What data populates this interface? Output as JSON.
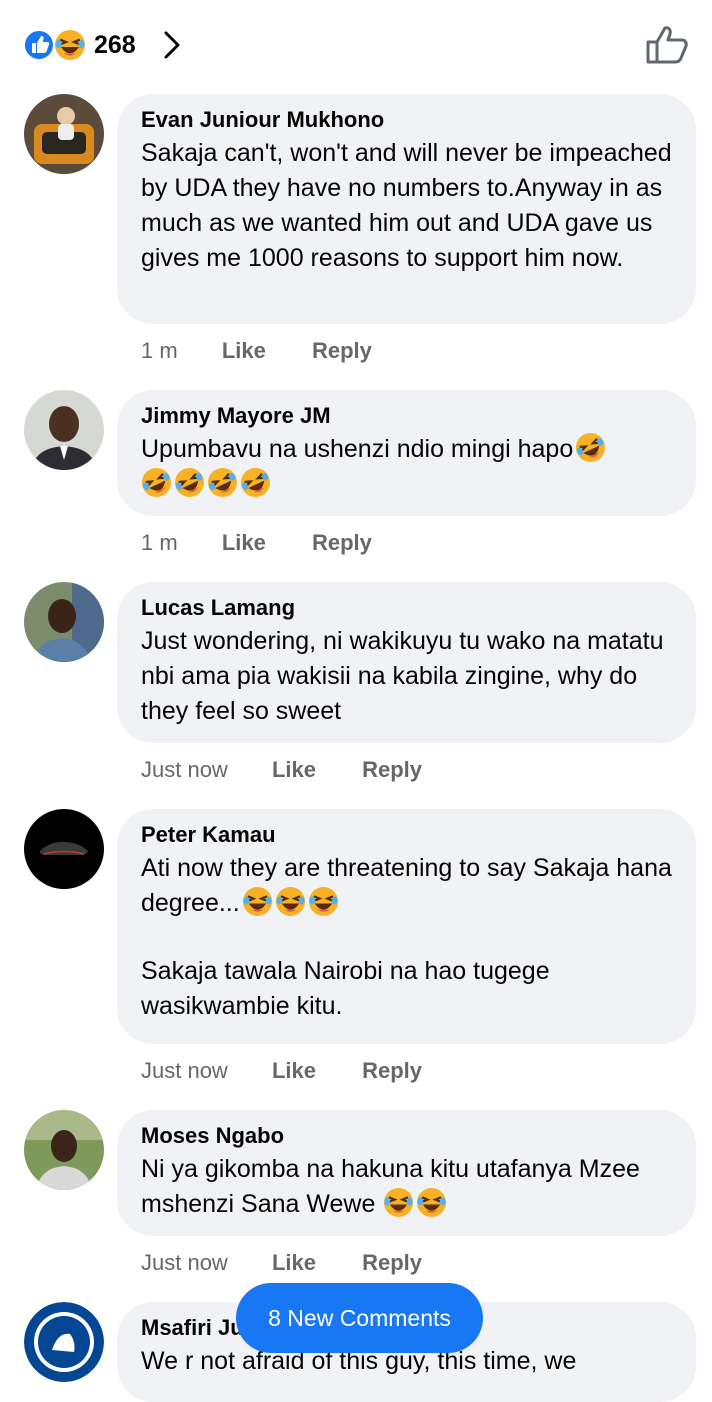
{
  "header": {
    "reaction_count": "268",
    "reaction_icons": [
      "like-icon",
      "haha-icon"
    ],
    "like_icon": "thumbs-up-outline-icon"
  },
  "comments": [
    {
      "author": "Evan Juniour Mukhono",
      "text": "Sakaja can't, won't and will never be impeached by UDA they have no numbers to.Anyway in as much as we wanted him out and UDA gave us gives me 1000 reasons to support him now.",
      "time": "1 m",
      "like": "Like",
      "reply": "Reply"
    },
    {
      "author": "Jimmy Mayore JM",
      "text": "Upumbavu na ushenzi ndio mingi hapo",
      "emoji": "rolling-on-floor-laughing",
      "time": "1 m",
      "like": "Like",
      "reply": "Reply"
    },
    {
      "author": "Lucas Lamang",
      "text": "Just wondering, ni wakikuyu tu wako na matatu nbi ama pia wakisii na kabila zingine, why do they feel so sweet",
      "time": "Just now",
      "like": "Like",
      "reply": "Reply"
    },
    {
      "author": "Peter Kamau",
      "text": "Ati now they are threatening to say Sakaja hana degree...",
      "text2": "Sakaja tawala Nairobi na hao tugege wasikwambie kitu.",
      "emoji": "tears-of-joy",
      "time": "Just now",
      "like": "Like",
      "reply": "Reply"
    },
    {
      "author": "Moses Ngabo",
      "text": "Ni ya gikomba na hakuna kitu utafanya Mzee mshenzi Sana Wewe",
      "emoji": "tears-of-joy",
      "time": "Just now",
      "like": "Like",
      "reply": "Reply"
    },
    {
      "author": "Msafiri Ju",
      "text": "We r not afraid of this guy, this time, we"
    }
  ],
  "new_comments_button": "8 New Comments",
  "colors": {
    "accent": "#1877f2",
    "bubble": "#f0f2f5",
    "meta_text": "#65676b",
    "haha": "#f7b125"
  }
}
